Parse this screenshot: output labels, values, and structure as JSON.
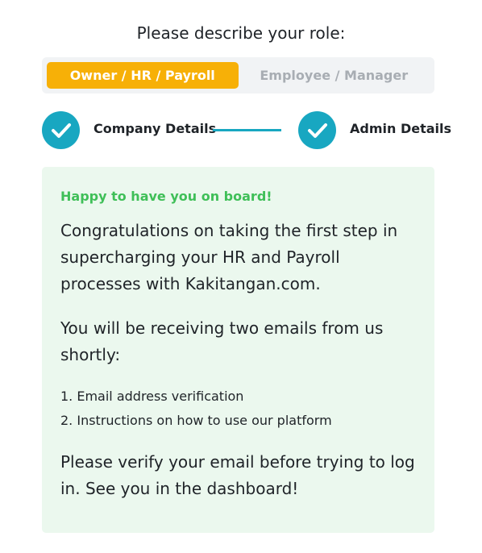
{
  "role_prompt": "Please describe your role:",
  "roles": [
    {
      "label": "Owner / HR / Payroll",
      "selected": true
    },
    {
      "label": "Employee / Manager",
      "selected": false
    }
  ],
  "steps": [
    {
      "label": "Company Details",
      "status": "complete",
      "icon": "checkmark-icon"
    },
    {
      "label": "Admin Details",
      "status": "complete",
      "icon": "checkmark-icon"
    }
  ],
  "message": {
    "headline": "Happy to have you on board!",
    "paragraph1": "Congratulations on taking the first step in supercharging your HR and Payroll processes with Kakitangan.com.",
    "paragraph2": "You will be receiving two emails from us shortly:",
    "list": [
      "1. Email address verification",
      "2. Instructions on how to use our platform"
    ],
    "paragraph3": "Please verify your email before trying to log in. See you in the dashboard!"
  },
  "colors": {
    "accent_orange": "#f7b007",
    "step_teal": "#18a7c1",
    "success_green": "#3fbf58",
    "card_bg": "#ebf8ee"
  }
}
